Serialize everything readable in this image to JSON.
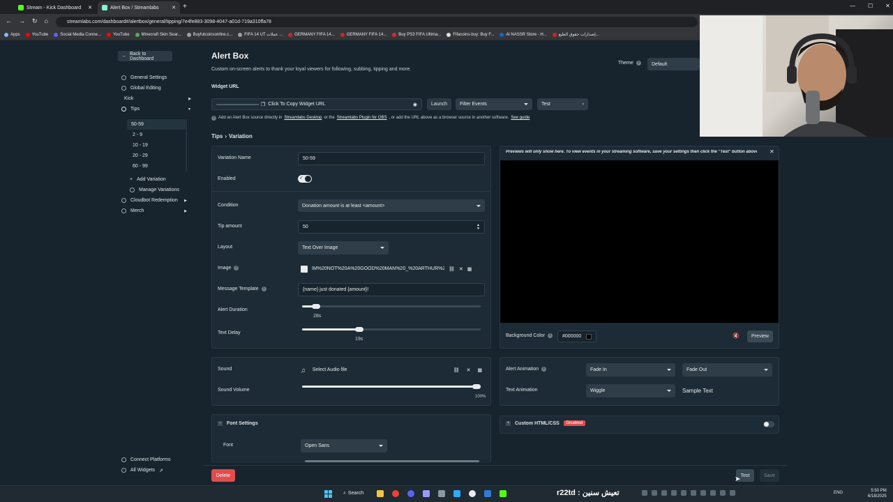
{
  "browser": {
    "tabs": [
      {
        "title": "Stream - Kick Dashboard",
        "color": "#53fc18"
      },
      {
        "title": "Alert Box / Streamlabs",
        "color": "#80f5d2"
      }
    ],
    "url": "streamlabs.com/dashboard#/alertbox/general/tipping/7e4fe883-3098-4047-a01d-719a310ffa78",
    "bookmarks": [
      {
        "label": "Apps",
        "color": "#8ab4f8"
      },
      {
        "label": "YouTube",
        "color": "#ff0000"
      },
      {
        "label": "Social Media Conne...",
        "color": "#5865f2"
      },
      {
        "label": "YouTube",
        "color": "#ff0000"
      },
      {
        "label": "Minecraft Skin Sear...",
        "color": "#4caf50"
      },
      {
        "label": "Buyfutcoinsonline.c...",
        "color": "#9aa0a6"
      },
      {
        "label": "FIFA 14 UT عملات ...",
        "color": "#9aa0a6"
      },
      {
        "label": "GERMANY FIFA 14...",
        "color": "#c62828"
      },
      {
        "label": "GERMANY FIFA 14...",
        "color": "#c62828"
      },
      {
        "label": "Buy PS3 FIFA Ultima...",
        "color": "#d32f2f"
      },
      {
        "label": "Fifacoins-buy: Buy F...",
        "color": "#e0e0e0"
      },
      {
        "label": "Al NASSR Store - H...",
        "color": "#1565c0"
      },
      {
        "label": "إصدارات حقوق الطبع...",
        "color": "#c62828"
      }
    ]
  },
  "sidebar": {
    "back": "Back to Dashboard",
    "items": [
      {
        "label": "General Settings",
        "icon": "gear-icon"
      },
      {
        "label": "Global Editing",
        "icon": "globe-icon"
      }
    ],
    "platform": "Kick",
    "tips_label": "Tips",
    "variations": [
      "50-59",
      "2 - 9",
      "10 - 19",
      "20 - 29",
      "60 - 99"
    ],
    "add_variation": "Add Variation",
    "manage_variations": "Manage Variations",
    "cloudbot": "Cloudbot Redemption",
    "merch": "Merch",
    "connect": "Connect Platforms",
    "all_widgets": "All Widgets"
  },
  "header": {
    "title": "Alert Box",
    "subtitle": "Custom on-screen alerts to thank your loyal viewers for following, subbing, tipping and more.",
    "theme_label": "Theme",
    "theme_value": "Default"
  },
  "widget_url": {
    "label": "Widget URL",
    "copy": "Click To Copy Widget URL",
    "launch": "Launch",
    "filter": "Filter Events",
    "test": "Test",
    "help_1": "Add an Alert Box source directly in",
    "help_link1": "Streamlabs Desktop",
    "help_2": "or the",
    "help_link2": "Streamlabs Plugin for OBS",
    "help_3": ", or add the URL above as a browser source in another software.",
    "help_link3": "See guide"
  },
  "breadcrumb": {
    "parent": "Tips",
    "sep": "›",
    "current": "Variation"
  },
  "form": {
    "variation_name_label": "Variation Name",
    "variation_name": "50-59",
    "enabled_label": "Enabled",
    "enabled": true,
    "condition_label": "Condition",
    "condition": "Donation amount is at least <amount>",
    "tip_amount_label": "Tip amount",
    "tip_amount": "50",
    "layout_label": "Layout",
    "layout": "Text Over Image",
    "image_label": "Image",
    "image_value": "IM%20NOT%20A%20GOOD%20MAN%20_%20ARTHUR%20M...",
    "template_label": "Message Template",
    "template": "{name} just donated {amount}!",
    "duration_label": "Alert Duration",
    "duration": "28s",
    "duration_frac": 0.08,
    "delay_label": "Text Delay",
    "delay": "19s",
    "delay_frac": 0.32
  },
  "preview": {
    "notice": "Previews will only show here. To view events in your streaming software, save your settings then click the \"Test\" button above.",
    "bg_label": "Background Color",
    "bg_value": "#000000",
    "preview_btn": "Preview"
  },
  "sound": {
    "sound_label": "Sound",
    "sound_value": "Select Audio file",
    "volume_label": "Sound Volume",
    "volume": "100%",
    "volume_frac": 1.0
  },
  "animation": {
    "alert_label": "Alert Animation",
    "in": "Fade In",
    "out": "Fade Out",
    "text_label": "Text Animation",
    "text_value": "Wiggle",
    "sample": "Sample Text"
  },
  "custom": {
    "label": "Custom HTML/CSS",
    "badge": "Disabled"
  },
  "font": {
    "section": "Font Settings",
    "font_label": "Font",
    "font_value": "Open Sans"
  },
  "footer": {
    "delete": "Delete",
    "test": "Test",
    "save": "Save"
  },
  "taskbar": {
    "search": "Search",
    "overlay": "r22td : تعيش سنين",
    "lang": "ENG",
    "time": "5:50 PM",
    "date": "6/18/2025"
  },
  "colors": {
    "accent": "#80f5d2",
    "danger": "#e34c4c",
    "bg": "#17242d"
  }
}
